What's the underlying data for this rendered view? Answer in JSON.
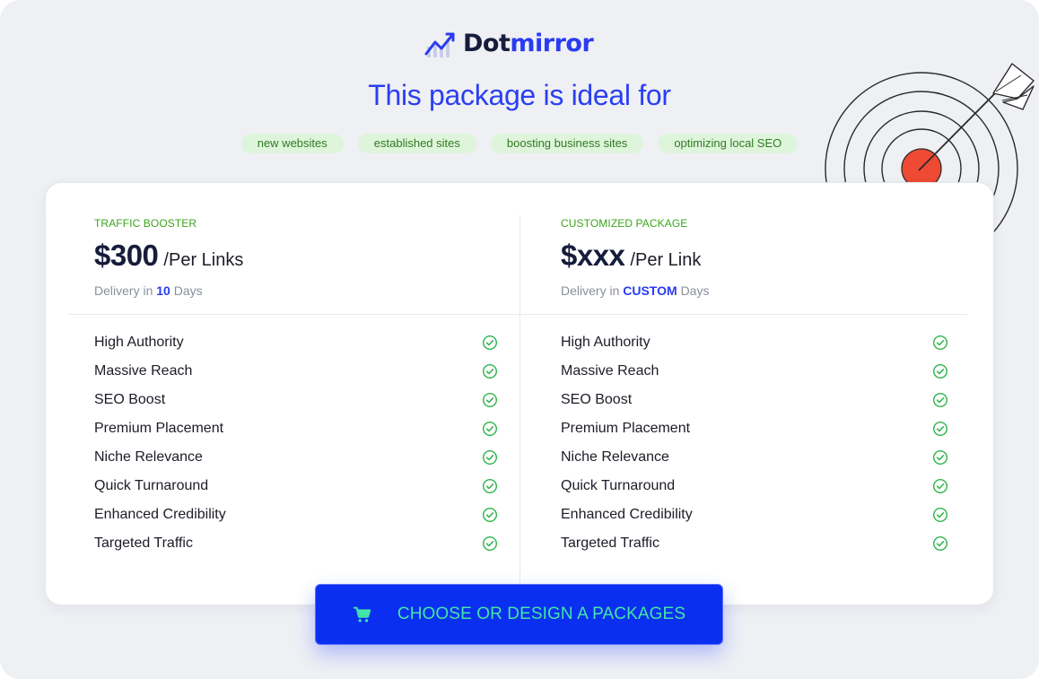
{
  "brand": {
    "name_part1": "Dot",
    "name_part2": "mirror"
  },
  "headline": "This package is ideal for",
  "tags": [
    "new websites",
    "established sites",
    "boosting business sites",
    "optimizing local SEO"
  ],
  "packages": [
    {
      "label": "TRAFFIC BOOSTER",
      "price": "$300",
      "per": "/Per Links",
      "delivery_prefix": "Delivery in",
      "delivery_value": "10",
      "delivery_suffix": "Days",
      "features": [
        "High Authority",
        "Massive Reach",
        "SEO Boost",
        "Premium Placement",
        "Niche Relevance",
        "Quick Turnaround",
        "Enhanced Credibility",
        "Targeted Traffic"
      ]
    },
    {
      "label": "CUSTOMIZED PACKAGE",
      "price": "$xxx",
      "per": "/Per Link",
      "delivery_prefix": "Delivery in",
      "delivery_value": "CUSTOM",
      "delivery_suffix": "Days",
      "features": [
        "High Authority",
        "Massive Reach",
        "SEO Boost",
        "Premium Placement",
        "Niche Relevance",
        "Quick Turnaround",
        "Enhanced Credibility",
        "Targeted Traffic"
      ]
    }
  ],
  "cta": {
    "label": "CHOOSE OR DESIGN A PACKAGES",
    "icon": "cart-icon"
  },
  "icons": {
    "logo": "trend-chart-logo-icon",
    "feature": "check-circle-icon",
    "illustration": "target-dart-icon"
  },
  "colors": {
    "accent_blue": "#2a3cf0",
    "cta_bg": "#0a2ff0",
    "cta_text": "#43e6a8",
    "tag_bg": "#dff5db",
    "check_green": "#2fb34a"
  }
}
